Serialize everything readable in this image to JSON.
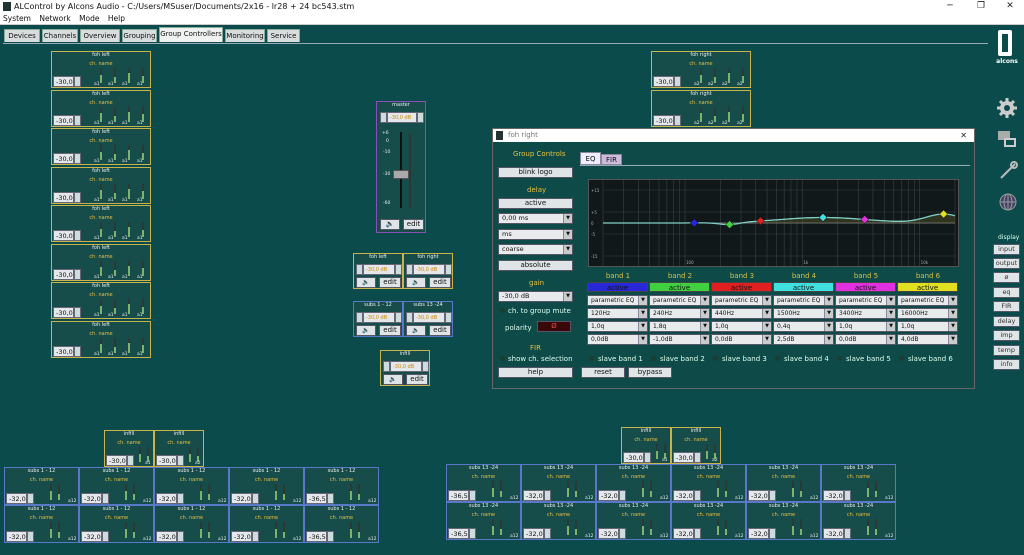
{
  "window": {
    "title": "ALControl by Alcons Audio - C:/Users/MSuser/Documents/2x16 - lr28 + 24 bc543.stm",
    "minimize": "─",
    "maximize": "❐",
    "close": "✕"
  },
  "menu": [
    "System",
    "Network",
    "Mode",
    "Help"
  ],
  "tabs": [
    "Devices",
    "Channels",
    "Overview",
    "Grouping",
    "Group Controllers",
    "Monitoring",
    "Service"
  ],
  "active_tab": "Group Controllers",
  "brand": {
    "logo_text": "alcons"
  },
  "sidebar": {
    "display_label": "display",
    "buttons": [
      "input",
      "output",
      "ø",
      "eq",
      "FIR",
      "delay",
      "imp",
      "temp",
      "info"
    ]
  },
  "common": {
    "ch_name": "ch. name",
    "edit": "edit",
    "a1": "a1",
    "a2": "a2",
    "a12": "a12"
  },
  "foh_left_boxes": {
    "title": "foh left",
    "values": [
      "-30,0",
      "-30,0",
      "-30,0",
      "-30,0",
      "-30,0",
      "-30,0",
      "-30,0",
      "-30,0"
    ]
  },
  "foh_right_boxes": {
    "title": "foh right",
    "values": [
      "-30,0",
      "-30,0"
    ]
  },
  "master": {
    "title": "master",
    "value": "-30,0 dB",
    "scale": [
      "+6",
      "0",
      "-10",
      "-30",
      "-60"
    ]
  },
  "groups": [
    {
      "title": "foh left",
      "value": "-30,0 dB"
    },
    {
      "title": "foh right",
      "value": "-30,0 dB"
    },
    {
      "title": "subs 1 - 12",
      "value": "-30,0 dB"
    },
    {
      "title": "subs 13 -24",
      "value": "-30,0 dB"
    },
    {
      "title": "infill",
      "value": "-30,0 dB"
    }
  ],
  "infill_left": {
    "title": "infill",
    "values": [
      "-30,0",
      "-30,0"
    ]
  },
  "infill_right": {
    "title": "infill",
    "values": [
      "-30,0",
      "-30,0"
    ]
  },
  "subs_left": {
    "title": "subs 1 - 12",
    "row1": [
      "-32,0",
      "-32,0",
      "-32,0",
      "-32,0",
      "-36,5"
    ],
    "row2": [
      "-32,0",
      "-32,0",
      "-32,0",
      "-32,0",
      "-36,5"
    ]
  },
  "subs_right": {
    "title": "subs 13 -24",
    "row1": [
      "-36,5",
      "-32,0",
      "-32,0",
      "-32,0",
      "-32,0",
      "-32,0"
    ],
    "row2": [
      "-36,5",
      "-32,0",
      "-32,0",
      "-32,0",
      "-32,0",
      "-32,0"
    ]
  },
  "dialog": {
    "title": "foh right",
    "group_controls": "Group Controls",
    "blink_logo": "blink logo",
    "delay_label": "delay",
    "delay_active": "active",
    "delay_value": "0,00 ms",
    "delay_unit": "ms",
    "delay_mode": "coarse",
    "delay_absolute": "absolute",
    "gain_label": "gain",
    "gain_value": "-30,0 dB",
    "ch_to_group_mute": "ch. to group mute",
    "polarity_label": "polarity",
    "polarity_value": "Ø",
    "fir_label": "FIR",
    "show_ch_selection": "show ch. selection",
    "help": "help",
    "reset": "reset",
    "bypass": "bypass",
    "tab_eq": "EQ",
    "tab_fir": "FIR",
    "plot_y_ticks": [
      "+15",
      "+5",
      "0",
      "-5",
      "-15"
    ],
    "plot_x_ticks": [
      "100",
      "1k",
      "10k"
    ],
    "bands": [
      {
        "name": "band 1",
        "state": "active",
        "color": "#2828d8",
        "type": "parametric EQ",
        "freq": "120Hz",
        "q": "1,0q",
        "gain": "0,0dB",
        "slave": "slave band 1"
      },
      {
        "name": "band 2",
        "state": "active",
        "color": "#40d040",
        "type": "parametric EQ",
        "freq": "240Hz",
        "q": "1,8q",
        "gain": "-1,0dB",
        "slave": "slave band 2"
      },
      {
        "name": "band 3",
        "state": "active",
        "color": "#e02020",
        "type": "parametric EQ",
        "freq": "440Hz",
        "q": "1,0q",
        "gain": "0,0dB",
        "slave": "slave band 3"
      },
      {
        "name": "band 4",
        "state": "active",
        "color": "#40e0e0",
        "type": "parametric EQ",
        "freq": "1500Hz",
        "q": "0,4q",
        "gain": "2,5dB",
        "slave": "slave band 4"
      },
      {
        "name": "band 5",
        "state": "active",
        "color": "#e030e0",
        "type": "parametric EQ",
        "freq": "3400Hz",
        "q": "1,0q",
        "gain": "0,0dB",
        "slave": "slave band 5"
      },
      {
        "name": "band 6",
        "state": "active",
        "color": "#e0e020",
        "type": "parametric EQ",
        "freq": "16000Hz",
        "q": "1,0q",
        "gain": "4,0dB",
        "slave": "slave band 6"
      }
    ]
  }
}
